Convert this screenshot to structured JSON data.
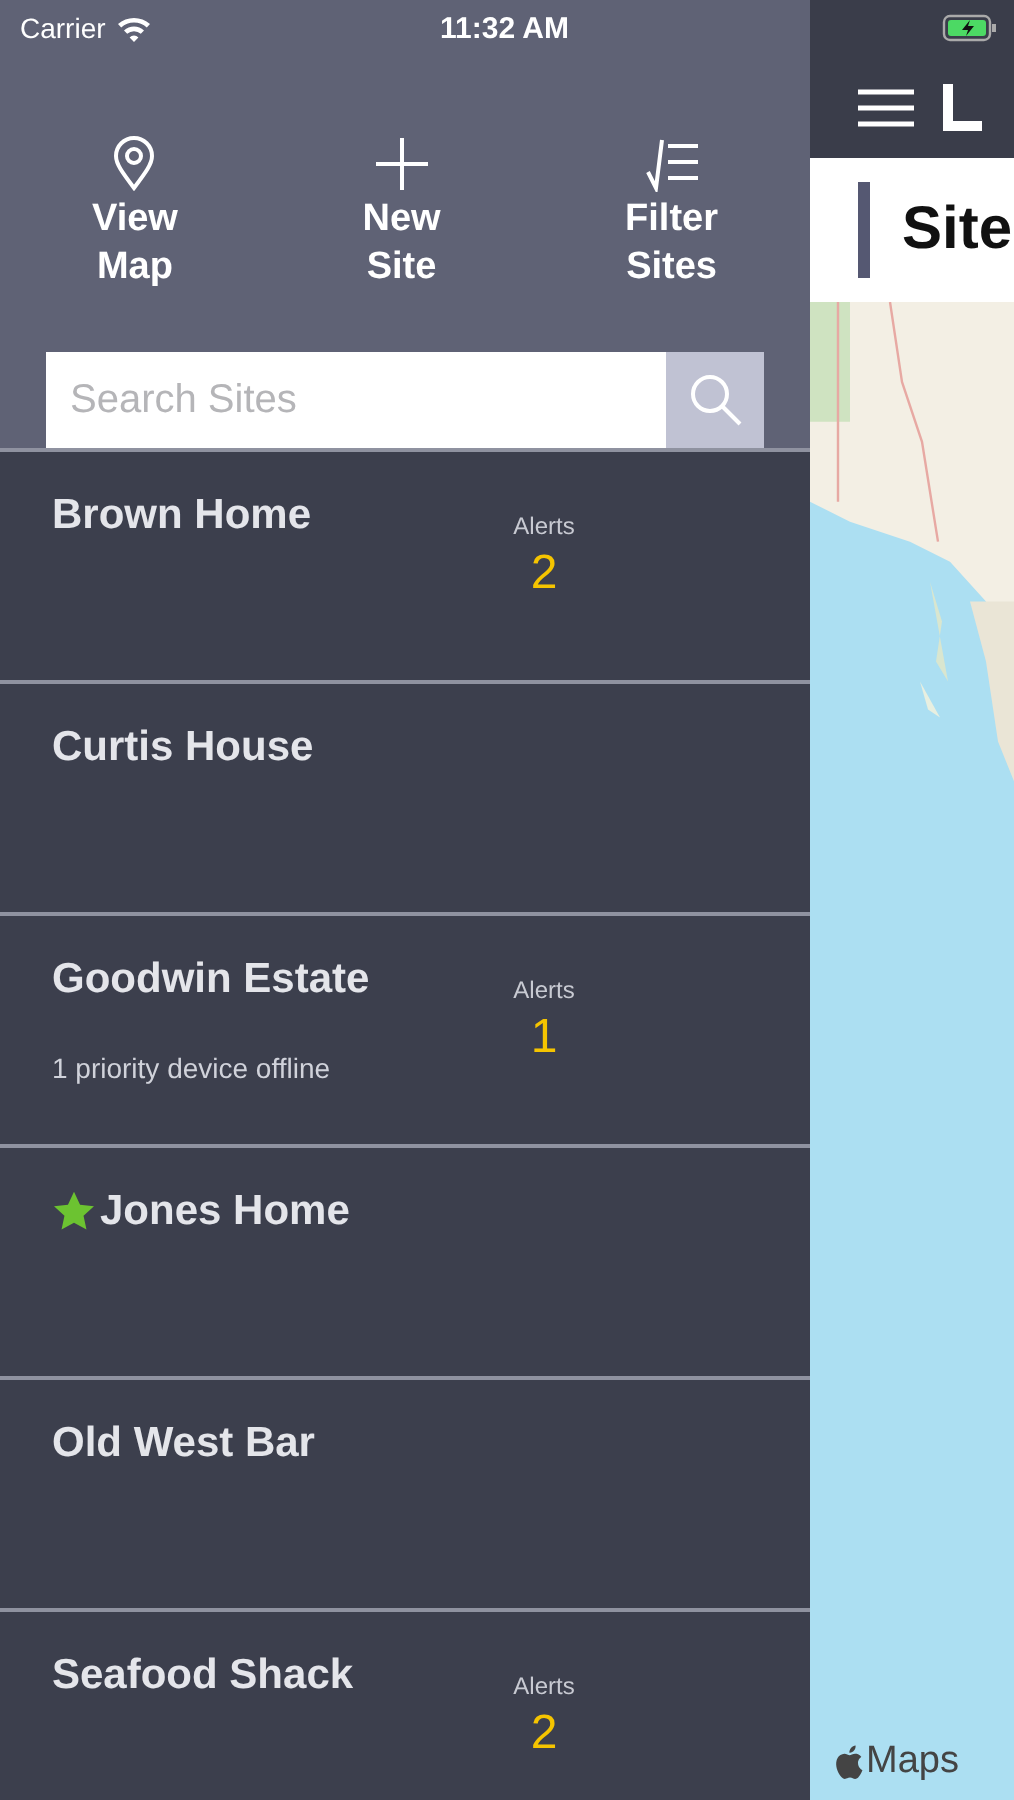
{
  "status_bar": {
    "carrier": "Carrier",
    "time": "11:32 AM"
  },
  "actions": [
    {
      "kind": "map",
      "label": "View\nMap"
    },
    {
      "kind": "add",
      "label": "New\nSite"
    },
    {
      "kind": "filter",
      "label": "Filter\nSites"
    }
  ],
  "search": {
    "placeholder": "Search Sites"
  },
  "sites": [
    {
      "name": "Brown Home",
      "favorite": false,
      "alerts_label": "Alerts",
      "alerts": "2"
    },
    {
      "name": "Curtis House",
      "favorite": false
    },
    {
      "name": "Goodwin Estate",
      "favorite": false,
      "alerts_label": "Alerts",
      "alerts": "1",
      "note": "1 priority device offline"
    },
    {
      "name": "Jones Home",
      "favorite": true
    },
    {
      "name": "Old West Bar",
      "favorite": false
    },
    {
      "name": "Seafood Shack",
      "favorite": false,
      "alerts_label": "Alerts",
      "alerts": "2"
    }
  ],
  "main": {
    "page_title": "Site",
    "map_attribution": "Maps"
  }
}
